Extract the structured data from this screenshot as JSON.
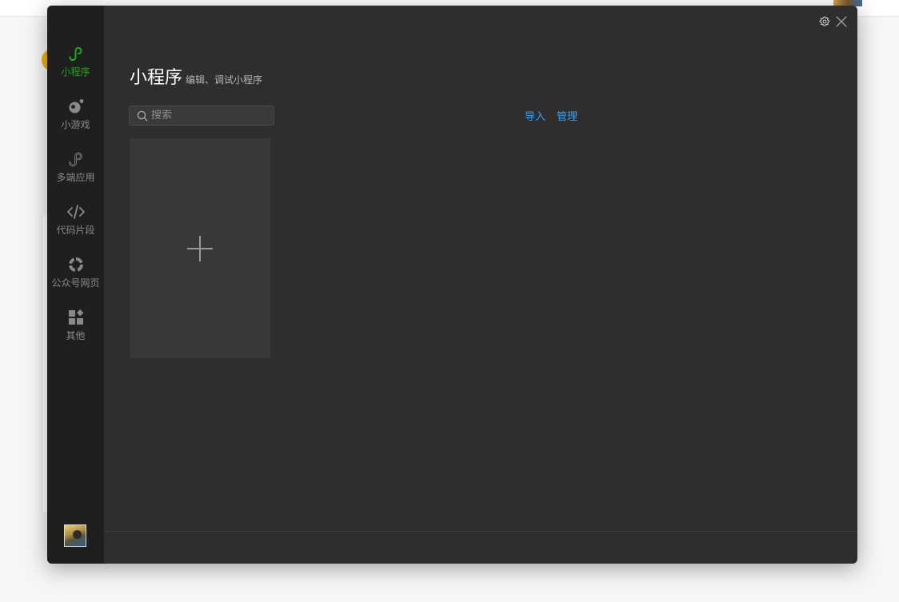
{
  "window": {
    "title": "小程序",
    "subtitle": "编辑、调试小程序"
  },
  "sidebar": {
    "items": [
      {
        "label": "小程序",
        "icon": "mini-program-icon",
        "active": true
      },
      {
        "label": "小游戏",
        "icon": "mini-game-icon",
        "active": false
      },
      {
        "label": "多端应用",
        "icon": "multi-platform-icon",
        "active": false
      },
      {
        "label": "代码片段",
        "icon": "code-snippet-icon",
        "active": false
      },
      {
        "label": "公众号网页",
        "icon": "official-account-icon",
        "active": false
      },
      {
        "label": "其他",
        "icon": "other-apps-icon",
        "active": false
      }
    ]
  },
  "search": {
    "placeholder": "搜索",
    "value": ""
  },
  "actions": {
    "import_label": "导入",
    "manage_label": "管理"
  },
  "colors": {
    "accent": "#1aad19",
    "link": "#3aa0f0",
    "background": "#2e2e2e",
    "sidebar": "#1f1f1f"
  }
}
